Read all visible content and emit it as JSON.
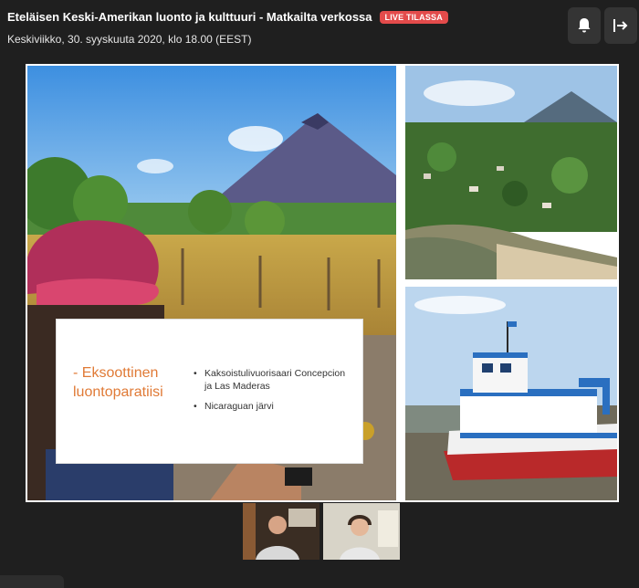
{
  "header": {
    "title": "Eteläisen Keski-Amerikan luonto ja kulttuuri - Matkailta verkossa",
    "live_badge": "LIVE TILASSA",
    "date": "Keskiviikko, 30. syyskuuta 2020, klo 18.00 (EEST)"
  },
  "icons": {
    "bell": "bell-icon",
    "leave": "exit-icon"
  },
  "slide": {
    "heading": "- Eksoottinen luontoparatiisi",
    "bullets": [
      "Kaksoistulivuorisaari Concepcion ja Las Maderas",
      "Nicaraguan järvi"
    ],
    "heading_color": "#e07a36"
  },
  "colors": {
    "background": "#1f1f1f",
    "live": "#e34b4b",
    "button": "#343434"
  }
}
